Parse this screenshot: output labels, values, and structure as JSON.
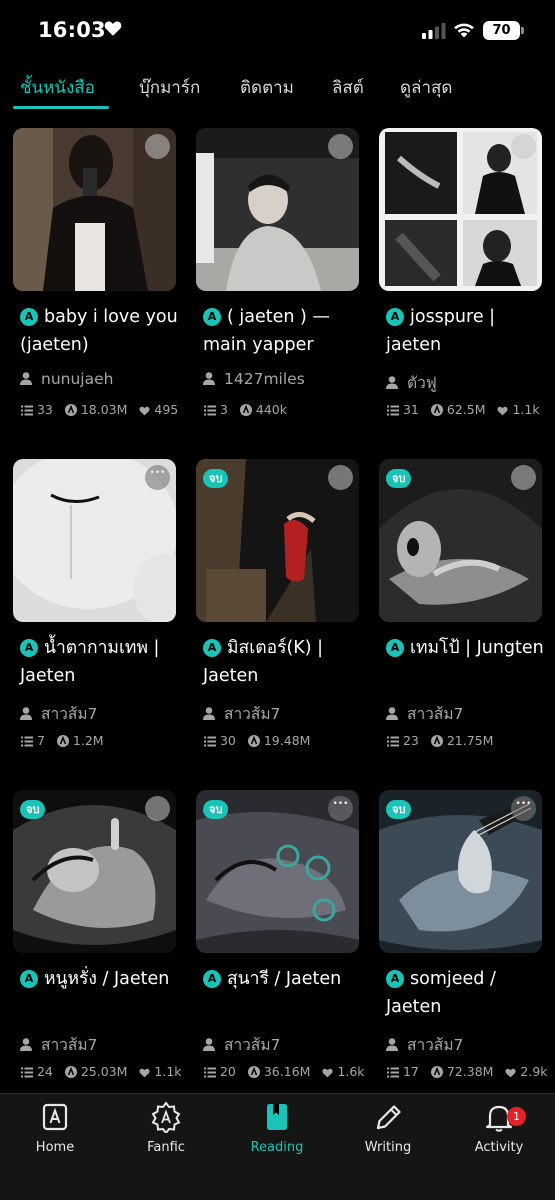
{
  "status": {
    "time": "16:03",
    "battery": "70"
  },
  "tabs": [
    {
      "label": "ชั้นหนังสือ",
      "active": true
    },
    {
      "label": "บุ๊กมาร์ก"
    },
    {
      "label": "ติดตาม"
    },
    {
      "label": "ลิสต์"
    },
    {
      "label": "ดูล่าสุด"
    }
  ],
  "books": [
    {
      "title": "baby i love you (jaeten)",
      "author": "nunujaeh",
      "chapters": "33",
      "reads": "18.03M",
      "likes": "495",
      "badge": ""
    },
    {
      "title": "( jaeten ) — main yapper",
      "author": "1427miles",
      "chapters": "3",
      "reads": "440k",
      "likes": "",
      "badge": ""
    },
    {
      "title": "josspure | jaeten",
      "author": "ตัวฟู",
      "chapters": "31",
      "reads": "62.5M",
      "likes": "1.1k",
      "badge": ""
    },
    {
      "title": "น้ำตากามเทพ | Jaeten",
      "author": "สาวส้ม7",
      "chapters": "7",
      "reads": "1.2M",
      "likes": "",
      "badge": ""
    },
    {
      "title": "มิสเตอร์(K) | Jaeten",
      "author": "สาวส้ม7",
      "chapters": "30",
      "reads": "19.48M",
      "likes": "",
      "badge": "จบ"
    },
    {
      "title": "เทมโป้ | Jungten",
      "author": "สาวส้ม7",
      "chapters": "23",
      "reads": "21.75M",
      "likes": "",
      "badge": "จบ"
    },
    {
      "title": "หนูหรั่ง / Jaeten",
      "author": "สาวส้ม7",
      "chapters": "24",
      "reads": "25.03M",
      "likes": "1.1k",
      "badge": "จบ"
    },
    {
      "title": "สุนารี / Jaeten",
      "author": "สาวส้ม7",
      "chapters": "20",
      "reads": "36.16M",
      "likes": "1.6k",
      "badge": "จบ"
    },
    {
      "title": "somjeed / Jaeten",
      "author": "สาวส้ม7",
      "chapters": "17",
      "reads": "72.38M",
      "likes": "2.9k",
      "badge": "จบ"
    }
  ],
  "nav": [
    {
      "label": "Home",
      "icon": "home-icon"
    },
    {
      "label": "Fanfic",
      "icon": "fanfic-icon"
    },
    {
      "label": "Reading",
      "icon": "reading-icon",
      "active": true
    },
    {
      "label": "Writing",
      "icon": "pencil-icon"
    },
    {
      "label": "Activity",
      "icon": "bell-icon",
      "badge": "1"
    }
  ],
  "colors": {
    "accent": "#19c3b7",
    "background": "#000000",
    "notification": "#e0242a"
  }
}
